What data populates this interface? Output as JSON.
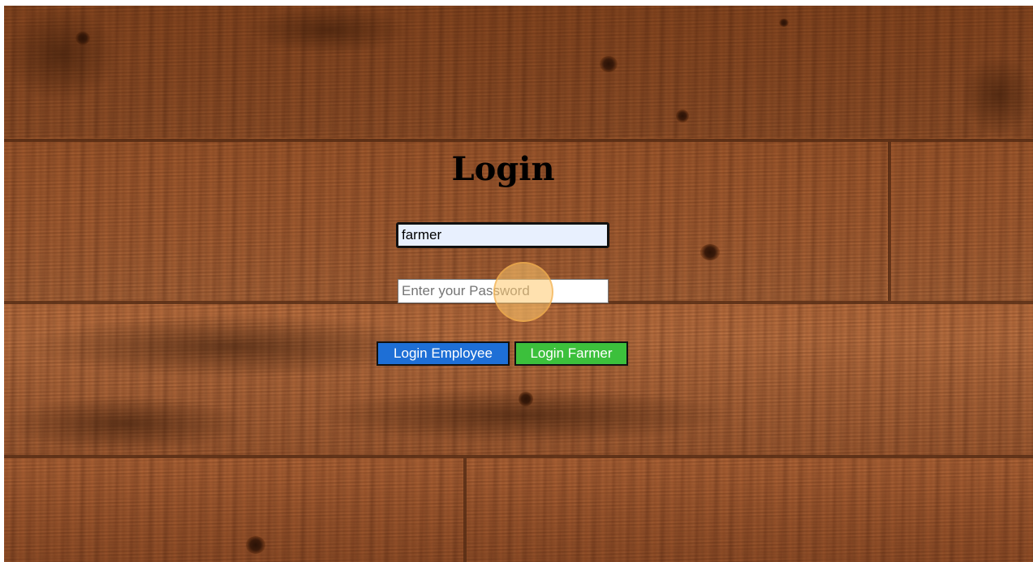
{
  "page": {
    "title": "Login"
  },
  "form": {
    "username_value": "farmer",
    "password_placeholder": "Enter your Password",
    "password_value": ""
  },
  "buttons": {
    "employee_label": "Login Employee",
    "farmer_label": "Login Farmer"
  },
  "colors": {
    "employee_button": "#1e6fd6",
    "farmer_button": "#3cc03c",
    "username_field_bg": "#e8f0fe",
    "wood_base": "#b56a3a"
  },
  "icons": {
    "cursor_indicator": "click-highlight-circle"
  }
}
